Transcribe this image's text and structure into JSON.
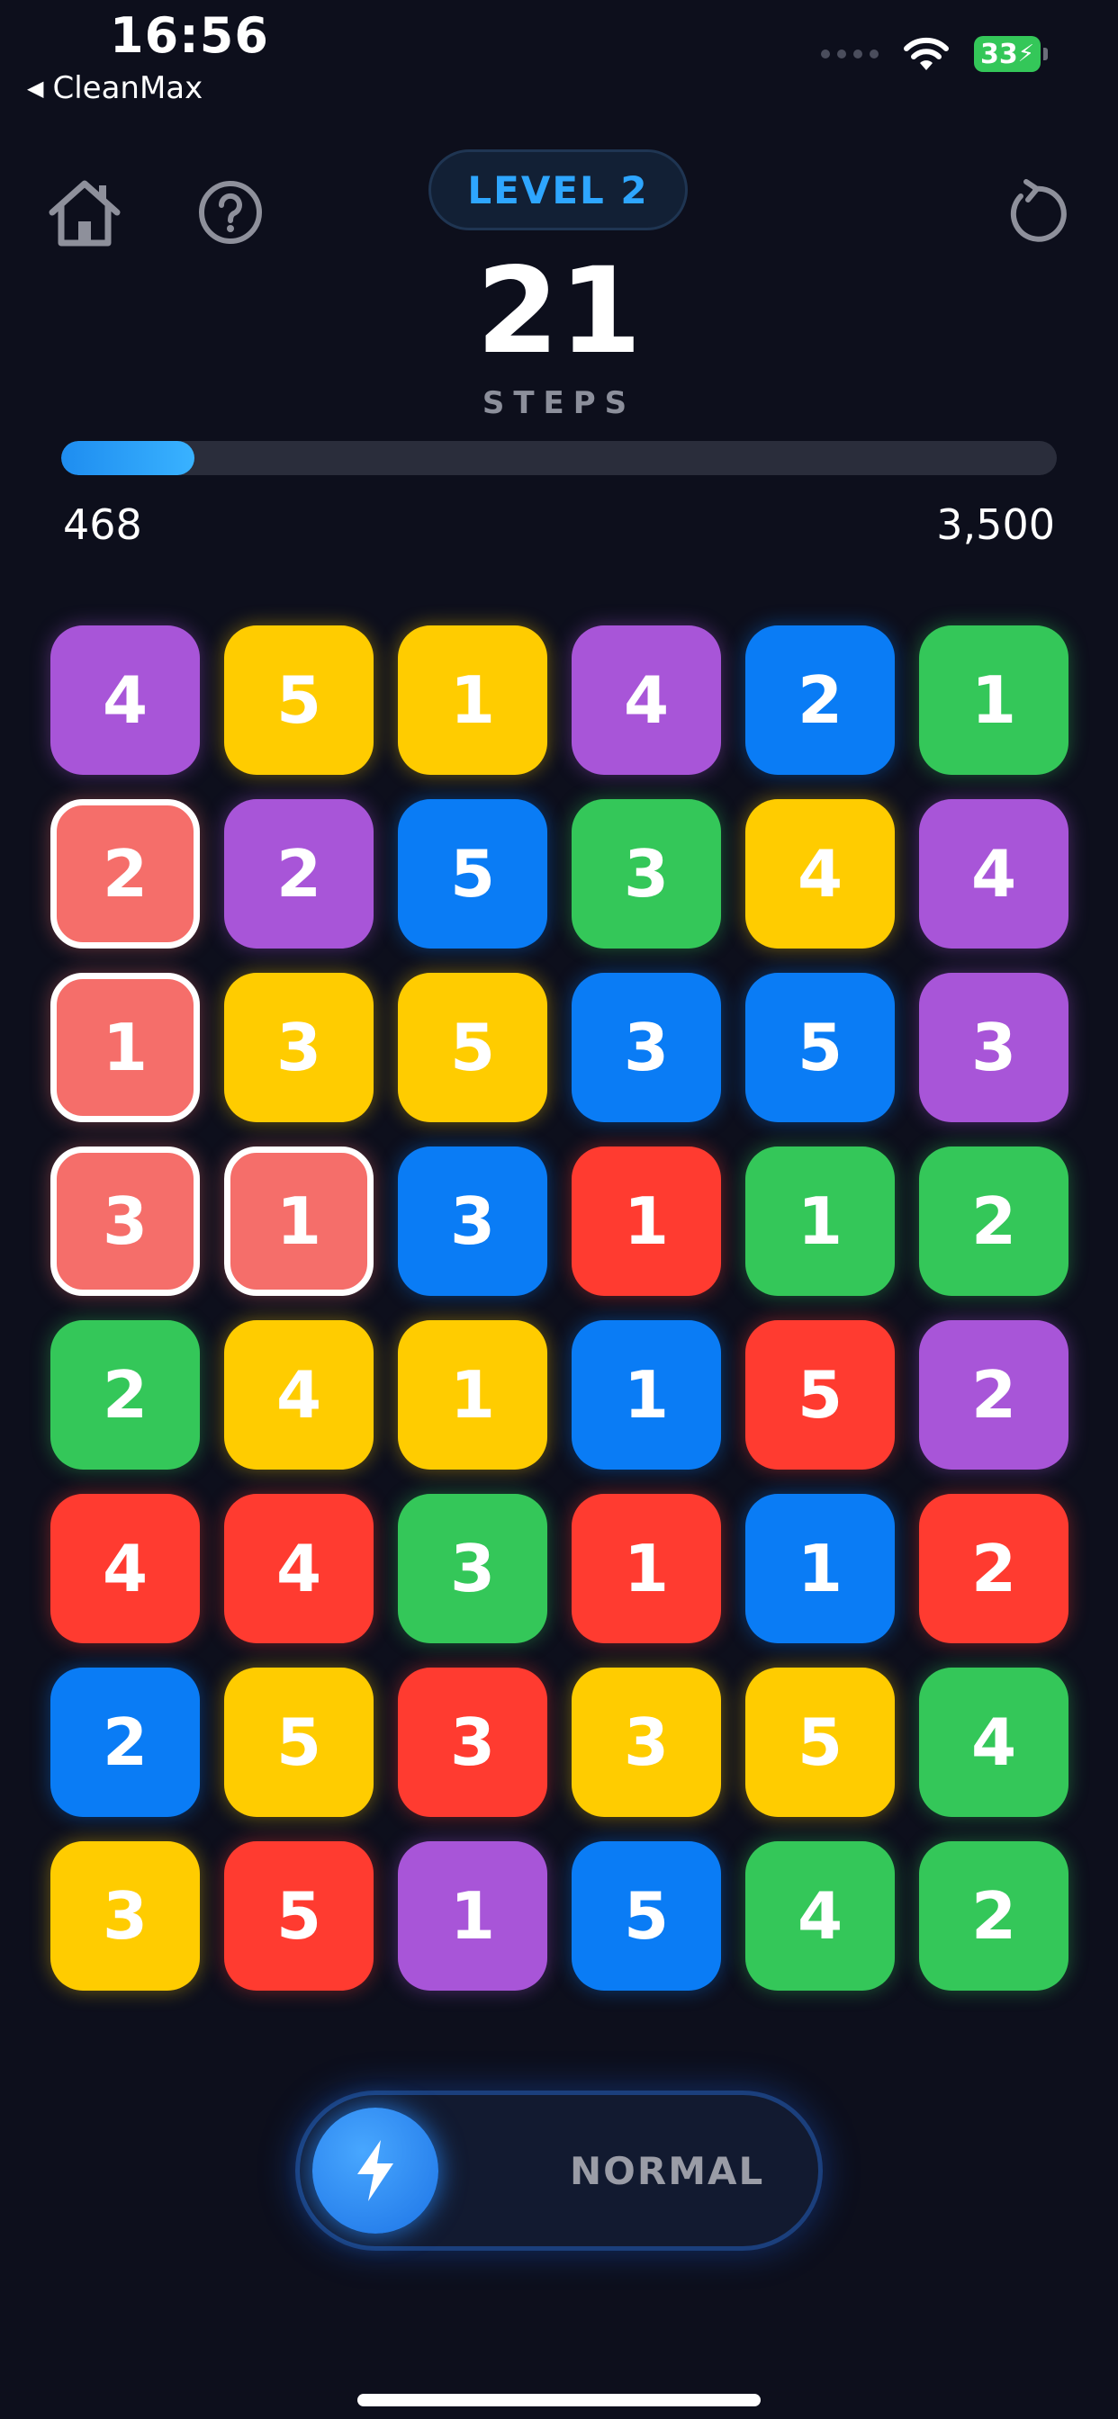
{
  "status_bar": {
    "time": "16:56",
    "back_app": "CleanMax",
    "battery": "33"
  },
  "header": {
    "level": "LEVEL 2",
    "steps": "21",
    "steps_label": "STEPS"
  },
  "icons": {
    "home": "home-icon",
    "help": "help-icon",
    "reset": "reset-icon",
    "bolt": "lightning-icon"
  },
  "progress": {
    "current": "468",
    "target": "3,500",
    "fraction": 0.134
  },
  "colors": {
    "purple": "#a855d8",
    "yellow": "#ffcc00",
    "blue": "#0a7cf5",
    "green": "#34c759",
    "red": "#ff3b30",
    "salmon": "#f56e6a",
    "background": "#0d0f1c",
    "accent": "#2ea6ff"
  },
  "board": {
    "rows": [
      [
        {
          "v": "4",
          "c": "purple"
        },
        {
          "v": "5",
          "c": "yellow"
        },
        {
          "v": "1",
          "c": "yellow"
        },
        {
          "v": "4",
          "c": "purple"
        },
        {
          "v": "2",
          "c": "blue"
        },
        {
          "v": "1",
          "c": "green"
        }
      ],
      [
        {
          "v": "2",
          "c": "salmon",
          "selected": true
        },
        {
          "v": "2",
          "c": "purple"
        },
        {
          "v": "5",
          "c": "blue"
        },
        {
          "v": "3",
          "c": "green"
        },
        {
          "v": "4",
          "c": "yellow"
        },
        {
          "v": "4",
          "c": "purple"
        }
      ],
      [
        {
          "v": "1",
          "c": "salmon",
          "selected": true
        },
        {
          "v": "3",
          "c": "yellow"
        },
        {
          "v": "5",
          "c": "yellow"
        },
        {
          "v": "3",
          "c": "blue"
        },
        {
          "v": "5",
          "c": "blue"
        },
        {
          "v": "3",
          "c": "purple"
        }
      ],
      [
        {
          "v": "3",
          "c": "salmon",
          "selected": true
        },
        {
          "v": "1",
          "c": "salmon",
          "selected": true
        },
        {
          "v": "3",
          "c": "blue"
        },
        {
          "v": "1",
          "c": "red"
        },
        {
          "v": "1",
          "c": "green"
        },
        {
          "v": "2",
          "c": "green"
        }
      ],
      [
        {
          "v": "2",
          "c": "green"
        },
        {
          "v": "4",
          "c": "yellow"
        },
        {
          "v": "1",
          "c": "yellow"
        },
        {
          "v": "1",
          "c": "blue"
        },
        {
          "v": "5",
          "c": "red"
        },
        {
          "v": "2",
          "c": "purple"
        }
      ],
      [
        {
          "v": "4",
          "c": "red"
        },
        {
          "v": "4",
          "c": "red"
        },
        {
          "v": "3",
          "c": "green"
        },
        {
          "v": "1",
          "c": "red"
        },
        {
          "v": "1",
          "c": "blue"
        },
        {
          "v": "2",
          "c": "red"
        }
      ],
      [
        {
          "v": "2",
          "c": "blue"
        },
        {
          "v": "5",
          "c": "yellow"
        },
        {
          "v": "3",
          "c": "red"
        },
        {
          "v": "3",
          "c": "yellow"
        },
        {
          "v": "5",
          "c": "yellow"
        },
        {
          "v": "4",
          "c": "green"
        }
      ],
      [
        {
          "v": "3",
          "c": "yellow"
        },
        {
          "v": "5",
          "c": "red"
        },
        {
          "v": "1",
          "c": "purple"
        },
        {
          "v": "5",
          "c": "blue"
        },
        {
          "v": "4",
          "c": "green"
        },
        {
          "v": "2",
          "c": "green"
        }
      ]
    ]
  },
  "mode": {
    "label": "NORMAL"
  }
}
